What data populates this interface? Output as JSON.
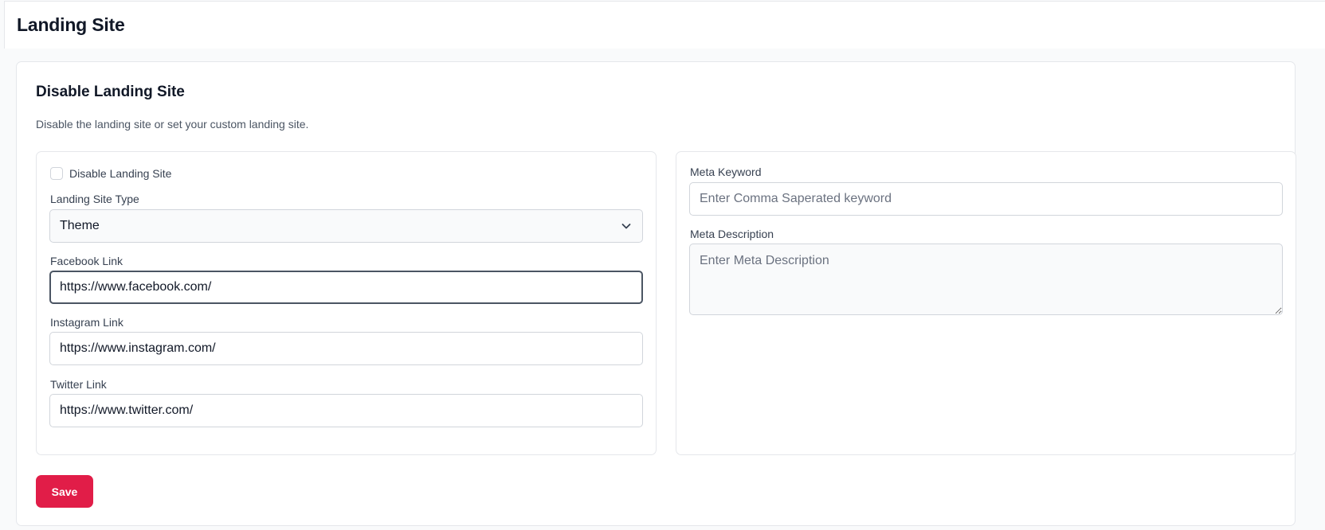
{
  "header": {
    "title": "Landing Site"
  },
  "card": {
    "title": "Disable Landing Site",
    "description": "Disable the landing site or set your custom landing site."
  },
  "left_panel": {
    "disable_checkbox": {
      "label": "Disable Landing Site",
      "checked": false
    },
    "landing_site_type": {
      "label": "Landing Site Type",
      "value": "Theme"
    },
    "facebook": {
      "label": "Facebook Link",
      "value": "https://www.facebook.com/"
    },
    "instagram": {
      "label": "Instagram Link",
      "value": "https://www.instagram.com/"
    },
    "twitter": {
      "label": "Twitter Link",
      "value": "https://www.twitter.com/"
    }
  },
  "right_panel": {
    "meta_keyword": {
      "label": "Meta Keyword",
      "placeholder": "Enter Comma Saperated keyword",
      "value": ""
    },
    "meta_description": {
      "label": "Meta Description",
      "placeholder": "Enter Meta Description",
      "value": ""
    }
  },
  "actions": {
    "save_label": "Save"
  },
  "colors": {
    "primary": "#e11d48",
    "border": "#e5e7eb",
    "input_border": "#d1d5db",
    "focus_border": "#4b5563"
  },
  "icons": {
    "select_chevron": "chevron-down-icon"
  }
}
